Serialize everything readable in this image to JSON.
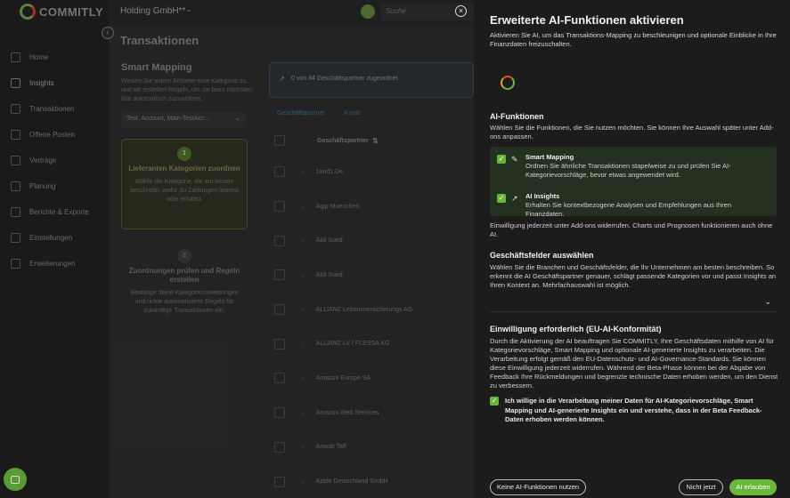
{
  "brand": {
    "logo_text": "COMMITLY"
  },
  "topbar": {
    "company": "Holding GmbH**",
    "search_placeholder": "Suche"
  },
  "sidebar": {
    "items": [
      {
        "label": "Home",
        "icon": "home-icon"
      },
      {
        "label": "Insights",
        "icon": "insights-icon"
      },
      {
        "label": "Transaktionen",
        "icon": "transactions-icon"
      },
      {
        "label": "Offene Posten",
        "icon": "open-items-icon"
      },
      {
        "label": "Verträge",
        "icon": "contracts-icon"
      },
      {
        "label": "Planung",
        "icon": "planning-icon"
      },
      {
        "label": "Berichte & Exporte",
        "icon": "reports-icon"
      },
      {
        "label": "Einstellungen",
        "icon": "settings-icon"
      },
      {
        "label": "Erweiterungen",
        "icon": "extensions-icon"
      }
    ]
  },
  "main": {
    "title": "Transaktionen",
    "smart_mapping": {
      "title": "Smart Mapping",
      "desc": "Weisen Sie jedem Anbieter eine Kategorie zu, und wir erstellen Regeln, um sie beim nächsten Mal automatisch zuzuordnen.",
      "select_value": "Test. Account, Main-TestAcc...",
      "step1": {
        "num": "1",
        "title": "Lieferanten Kategorien zuordnen",
        "desc": "Wähle die Kategorie, die am besten beschreibt, wofür du Zahlungen leistest oder erhältst."
      },
      "step2": {
        "num": "2",
        "title": "Zuordnungen prüfen und Regeln erstellen",
        "desc": "Bestätige deine Kategoriezuweisungen und richte automatisierte Regeln für zukünftige Transaktionen ein."
      }
    },
    "counter": "0 von 84 Geschäftspartner zugeordnet",
    "tabs": [
      "Geschäftspartner",
      "Konto"
    ],
    "table": {
      "header": "Geschäftspartner",
      "rows": [
        "1und1.De",
        "Agip Muenchen",
        "Aldi Sued",
        "Aldi Sued",
        "ALLIANZ Lebensversicherungs AG",
        "ALLIANZ LV / FLESSA KG",
        "Amazon Europe SA",
        "Amazon Web Services",
        "Anwalt Taff",
        "Apple Deutschland GmbH"
      ]
    }
  },
  "drawer": {
    "title": "Erweiterte AI-Funktionen aktivieren",
    "intro": "Aktivieren Sie AI, um das Transaktions-Mapping zu beschleunigen und optionale Einblicke in Ihre Finanzdaten freizuschalten.",
    "features_title": "AI-Funktionen",
    "features_desc": "Wählen Sie die Funktionen, die Sie nutzen möchten. Sie können Ihre Auswahl später unter Add-ons anpassen.",
    "features": [
      {
        "name": "Smart Mapping",
        "desc": "Ordnen Sie ähnliche Transaktionen stapelweise zu und prüfen Sie AI-Kategorievorschläge, bevor etwas angewendet wird.",
        "checked": true
      },
      {
        "name": "AI Insights",
        "desc": "Erhalten Sie kontextbezogene Analysen und Empfehlungen aus Ihren Finanzdaten.",
        "checked": true
      }
    ],
    "revoke_note": "Einwilligung jederzeit unter Add-ons widerrufen. Charts und Prognosen funktionieren auch ohne AI.",
    "business_title": "Geschäftsfelder auswählen",
    "business_desc": "Wählen Sie die Branchen und Geschäftsfelder, die Ihr Unternehmen am besten beschreiben. So erkennt die AI Geschäftspartner genauer, schlägt passende Kategorien vor und passt Insights an Ihren Kontext an. Mehrfachauswahl ist möglich.",
    "consent_title": "Einwilligung erforderlich (EU-AI-Konformität)",
    "consent_desc": "Durch die Aktivierung der AI beauftragen Sie COMMITLY, Ihre Geschäftsdaten mithilfe von AI für Kategorievorschläge, Smart Mapping und optionale AI-generierte Insights zu verarbeiten. Die Verarbeitung erfolgt gemäß den EU-Datenschutz- und AI-Governance-Standards. Sie können diese Einwilligung jederzeit widerrufen. Während der Beta-Phase können bei der Abgabe von Feedback Ihre Rückmeldungen und begrenzte technische Daten erhoben werden, um den Dienst zu verbessern.",
    "consent_checkbox": "Ich willige in die Verarbeitung meiner Daten für AI-Kategorievorschläge, Smart Mapping und AI-generierte Insights ein und verstehe, dass in der Beta Feedback-Daten erhoben werden können.",
    "buttons": {
      "decline": "Keine AI-Funktionen nutzen",
      "later": "Nicht jetzt",
      "accept": "AI erlauben"
    }
  }
}
